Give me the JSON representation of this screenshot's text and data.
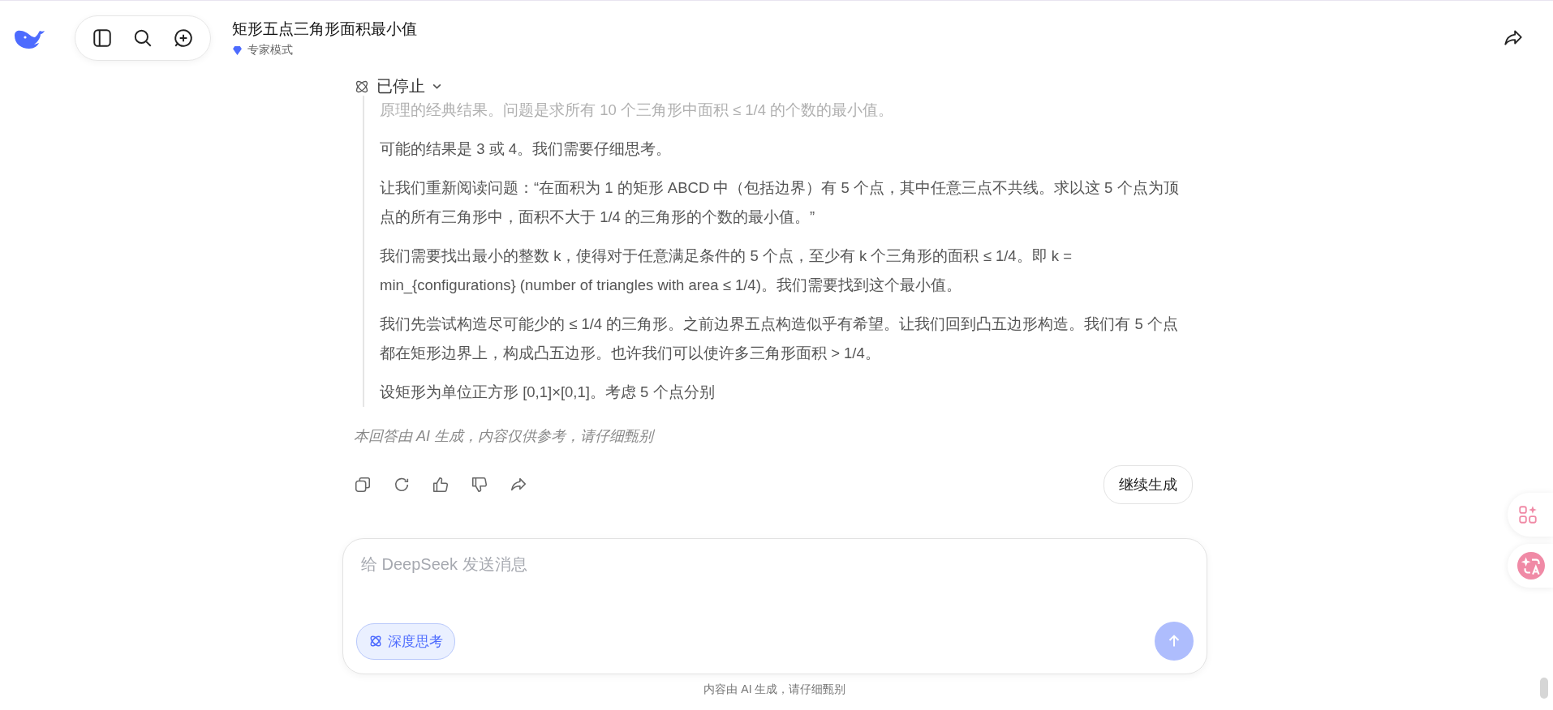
{
  "header": {
    "title": "矩形五点三角形面积最小值",
    "mode": "专家模式"
  },
  "thinking": {
    "status": "已停止",
    "expanded": true,
    "paragraphs": [
      "原理的经典结果。问题是求所有 10 个三角形中面积 ≤ 1/4 的个数的最小值。",
      "可能的结果是 3 或 4。我们需要仔细思考。",
      "让我们重新阅读问题：“在面积为 1 的矩形 ABCD 中（包括边界）有 5 个点，其中任意三点不共线。求以这 5 个点为顶点的所有三角形中，面积不大于 1/4 的三角形的个数的最小值。”",
      "我们需要找出最小的整数 k，使得对于任意满足条件的 5 个点，至少有 k 个三角形的面积 ≤ 1/4。即 k = min_{configurations} (number of triangles with area ≤ 1/4)。我们需要找到这个最小值。",
      "我们先尝试构造尽可能少的 ≤ 1/4 的三角形。之前边界五点构造似乎有希望。让我们回到凸五边形构造。我们有 5 个点都在矩形边界上，构成凸五边形。也许我们可以使许多三角形面积 > 1/4。",
      "设矩形为单位正方形 [0,1]×[0,1]。考虑 5 个点分别"
    ]
  },
  "disclaimer": "本回答由 AI 生成，内容仅供参考，请仔细甄别",
  "continue_button": "继续生成",
  "input": {
    "placeholder": "给 DeepSeek 发送消息",
    "deep_think": {
      "label": "深度思考",
      "selected": true
    }
  },
  "footer": "内容由 AI 生成，请仔细甄别"
}
